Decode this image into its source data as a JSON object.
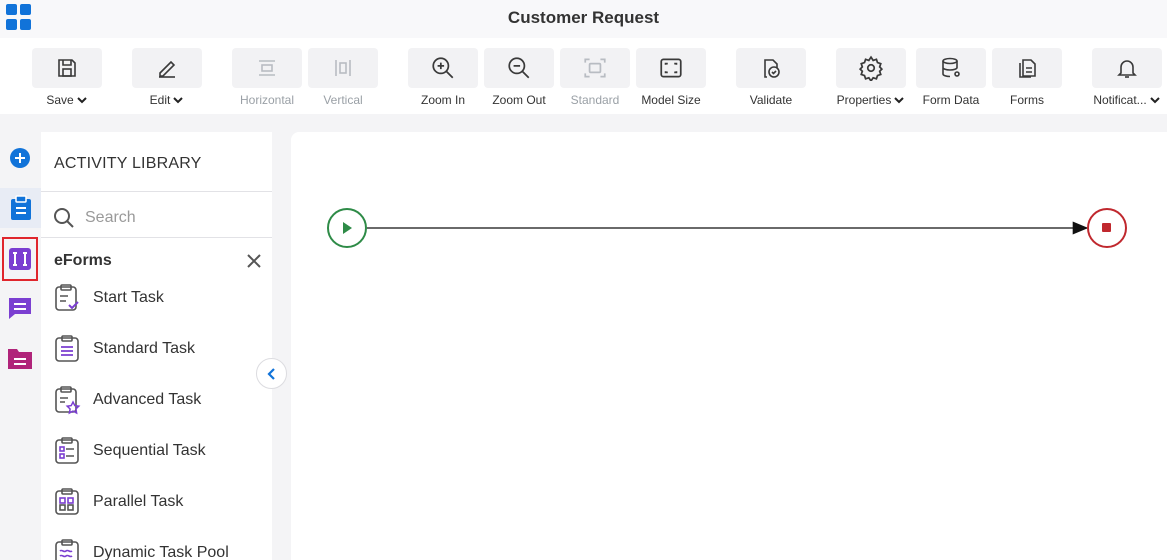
{
  "header": {
    "title": "Customer Request"
  },
  "toolbar": {
    "save": "Save",
    "edit": "Edit",
    "horizontal": "Horizontal",
    "vertical": "Vertical",
    "zoom_in": "Zoom In",
    "zoom_out": "Zoom Out",
    "standard": "Standard",
    "model_size": "Model Size",
    "validate": "Validate",
    "properties": "Properties",
    "form_data": "Form Data",
    "forms": "Forms",
    "notifications": "Notificat..."
  },
  "library": {
    "title": "ACTIVITY LIBRARY",
    "search_placeholder": "Search",
    "category": "eForms",
    "items": [
      {
        "label": "Start Task",
        "icon": "start-task-icon"
      },
      {
        "label": "Standard Task",
        "icon": "standard-task-icon"
      },
      {
        "label": "Advanced Task",
        "icon": "advanced-task-icon"
      },
      {
        "label": "Sequential Task",
        "icon": "sequential-task-icon"
      },
      {
        "label": "Parallel Task",
        "icon": "parallel-task-icon"
      },
      {
        "label": "Dynamic Task Pool",
        "icon": "dynamic-task-pool-icon"
      }
    ]
  },
  "colors": {
    "accent_blue": "#1173d9",
    "purple": "#7b3fd1",
    "magenta": "#b0247a",
    "start_green": "#2e8b47",
    "end_red": "#c0282e",
    "selected_outline": "#e0262c"
  }
}
